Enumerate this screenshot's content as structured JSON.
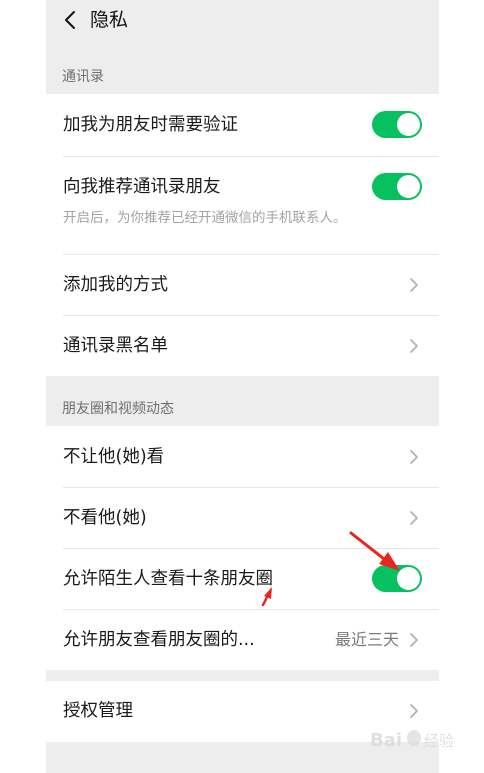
{
  "header": {
    "title": "隐私"
  },
  "sections": {
    "contacts_header": "通讯录",
    "moments_header": "朋友圈和视频动态"
  },
  "contacts": {
    "verify_label": "加我为朋友时需要验证",
    "verify_on": true,
    "recommend_label": "向我推荐通讯录朋友",
    "recommend_on": true,
    "recommend_desc": "开启后，为你推荐已经开通微信的手机联系人。",
    "add_methods_label": "添加我的方式",
    "blacklist_label": "通讯录黑名单"
  },
  "moments": {
    "hide_my_posts_label": "不让他(她)看",
    "hide_their_posts_label": "不看他(她)",
    "stranger_ten_label": "允许陌生人查看十条朋友圈",
    "stranger_ten_on": true,
    "friends_range_label": "允许朋友查看朋友圈的...",
    "friends_range_value": "最近三天"
  },
  "auth": {
    "label": "授权管理"
  },
  "colors": {
    "toggle_on": "#07c160",
    "annotation_arrow": "#e8261f",
    "page_bg": "#ededed"
  },
  "icons": {
    "back": "chevron-left-icon",
    "more": "chevron-right-icon"
  },
  "watermark": {
    "text": "Bai 经验"
  }
}
